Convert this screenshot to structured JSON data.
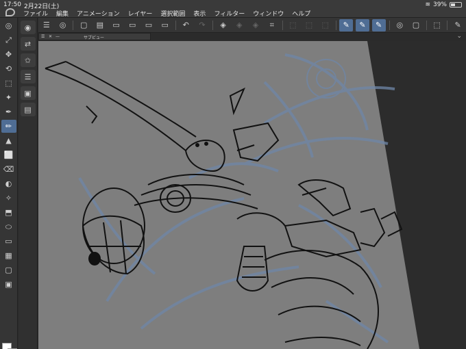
{
  "status": {
    "time": "17:50",
    "date": "2月22日(土)",
    "battery": "39%"
  },
  "menu": [
    "ファイル",
    "編集",
    "アニメーション",
    "レイヤー",
    "選択範囲",
    "表示",
    "フィルター",
    "ウィンドウ",
    "ヘルプ"
  ],
  "subview": {
    "title": "サブビュー",
    "dash": "—",
    "close": "✕"
  },
  "icons": {
    "menu": "☰",
    "layer": "◎",
    "new": "▢",
    "open": "▤",
    "save": "▭",
    "undo": "↶",
    "redo": "↷",
    "fill": "◈",
    "transform": "⌗",
    "pen": "✎",
    "select": "⬚"
  },
  "tools": [
    "◎",
    "⤢",
    "✥",
    "⟲",
    "⬚",
    "✦",
    "✒",
    "✏",
    "▲",
    "⬜",
    "⌫",
    "◐",
    "✧",
    "⬒",
    "⬭",
    "▭",
    "▦",
    "▢",
    "▣"
  ],
  "subtools": [
    "◉",
    "⇄",
    "✩",
    "☰",
    "▣",
    "▤"
  ],
  "colors": {
    "accent": "#4f6d94",
    "canvas": "#7d7d7d",
    "paper": "#8a8a8a",
    "sketch": "#6f87a8"
  }
}
